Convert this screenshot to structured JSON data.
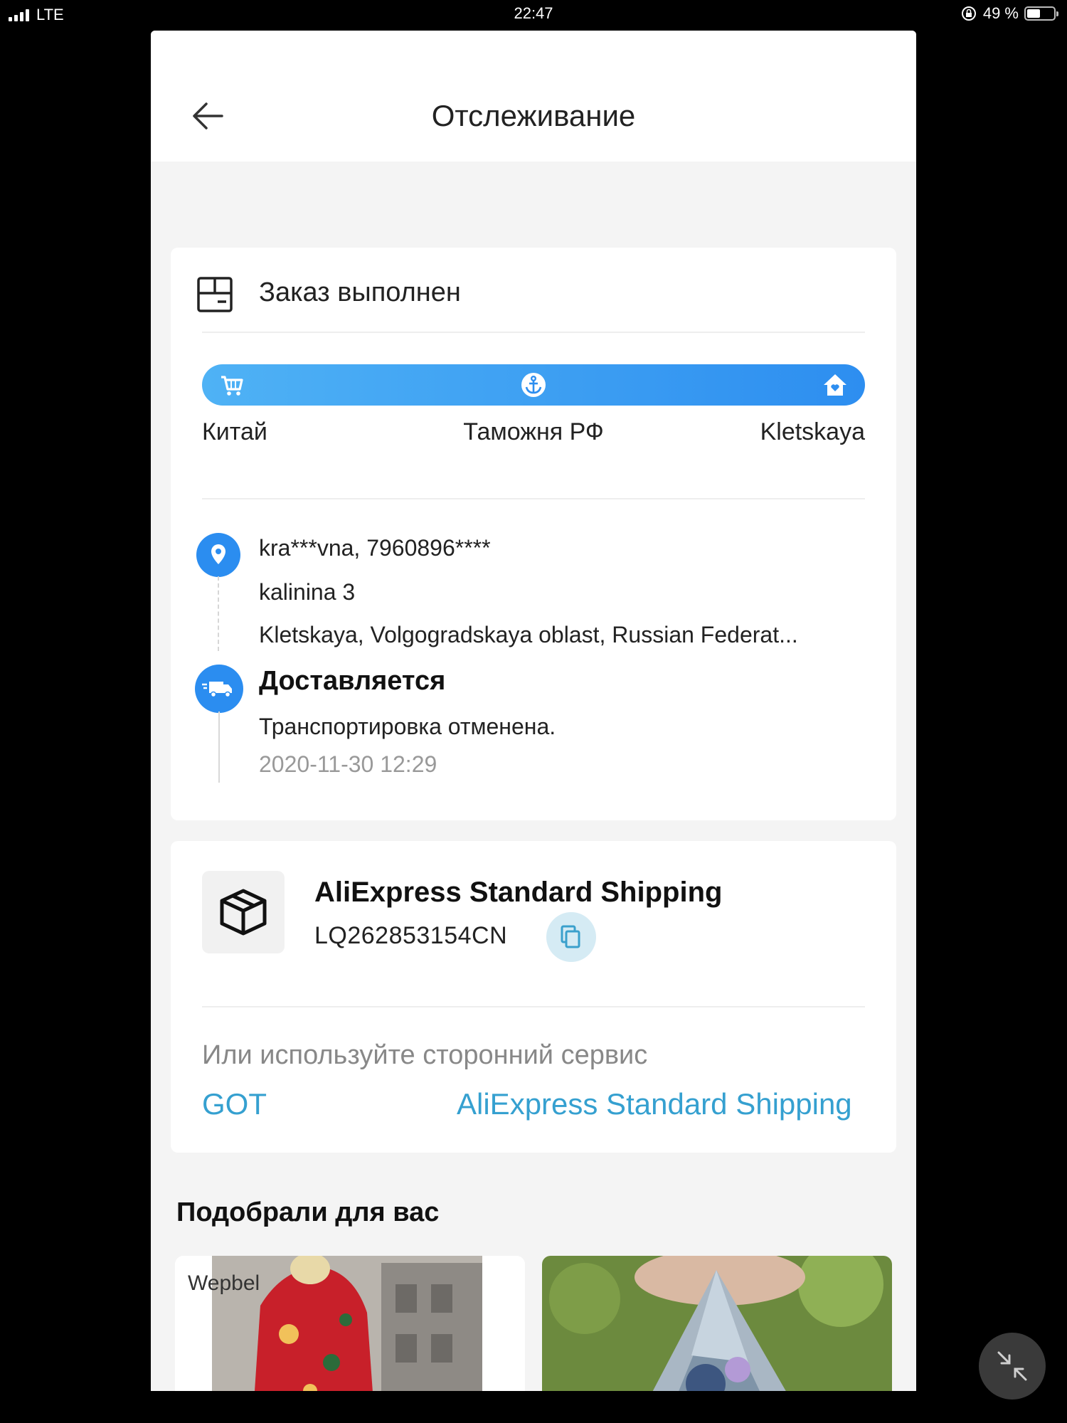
{
  "statusbar": {
    "carrier": "LTE",
    "time": "22:47",
    "battery_text": "49 %",
    "battery_level": 0.49
  },
  "header": {
    "title": "Отслеживание"
  },
  "order": {
    "status": "Заказ выполнен",
    "progress_steps": [
      "Китай",
      "Таможня РФ",
      "Kletskaya"
    ],
    "address": {
      "recipient": "kra***vna, 7960896****",
      "street": "kalinina 3",
      "region": "Kletskaya, Volgogradskaya oblast, Russian Federat..."
    },
    "delivery": {
      "title": "Доставляется",
      "message": "Транспортировка отменена.",
      "timestamp": "2020-11-30 12:29"
    }
  },
  "shipping": {
    "service": "AliExpress Standard Shipping",
    "tracking_number": "LQ262853154CN",
    "alt_label": "Или используйте сторонний сервис",
    "alt_links": [
      "GOT",
      "AliExpress Standard Shipping"
    ]
  },
  "recommendations": {
    "title": "Подобрали для вас",
    "items": [
      {
        "brand": "Wepbel"
      },
      {
        "brand": ""
      }
    ]
  },
  "colors": {
    "accent": "#2b8df0",
    "link": "#35a0d0"
  }
}
